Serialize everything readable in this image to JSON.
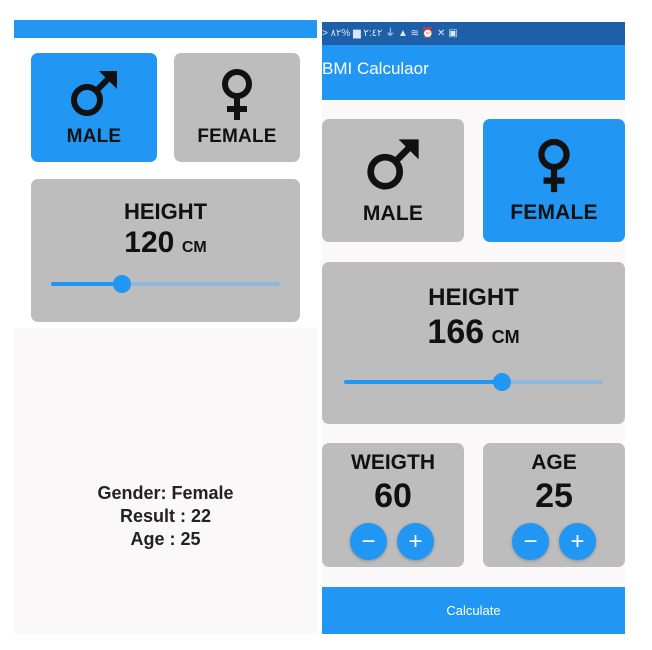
{
  "left": {
    "gender": {
      "male_label": "MALE",
      "female_label": "FEMALE",
      "selected": "male"
    },
    "height": {
      "title": "HEIGHT",
      "value": "120",
      "unit": "CM",
      "fraction": 0.31
    },
    "result": {
      "gender_line": "Gender: Female",
      "result_line": "Result : 22",
      "age_line": "Age : 25"
    }
  },
  "right": {
    "status_bar_text": "> ٢:٤٢ ▆ %٨٢ ⏚ ▲ ≋ ⏰ ✕ ▣",
    "app_title": "BMI Calculaor",
    "gender": {
      "male_label": "MALE",
      "female_label": "FEMALE",
      "selected": "female"
    },
    "height": {
      "title": "HEIGHT",
      "value": "166",
      "unit": "CM",
      "fraction": 0.61
    },
    "weight": {
      "title": "WEIGTH",
      "value": "60",
      "minus": "−",
      "plus": "+"
    },
    "age": {
      "title": "AGE",
      "value": "25",
      "minus": "−",
      "plus": "+"
    },
    "calculate_label": "Calculate"
  },
  "colors": {
    "accent": "#2196f3",
    "card": "#bdbdbd",
    "status_bar": "#1e5fa8"
  },
  "icons": {
    "male": "male-symbol-icon",
    "female": "female-symbol-icon"
  }
}
